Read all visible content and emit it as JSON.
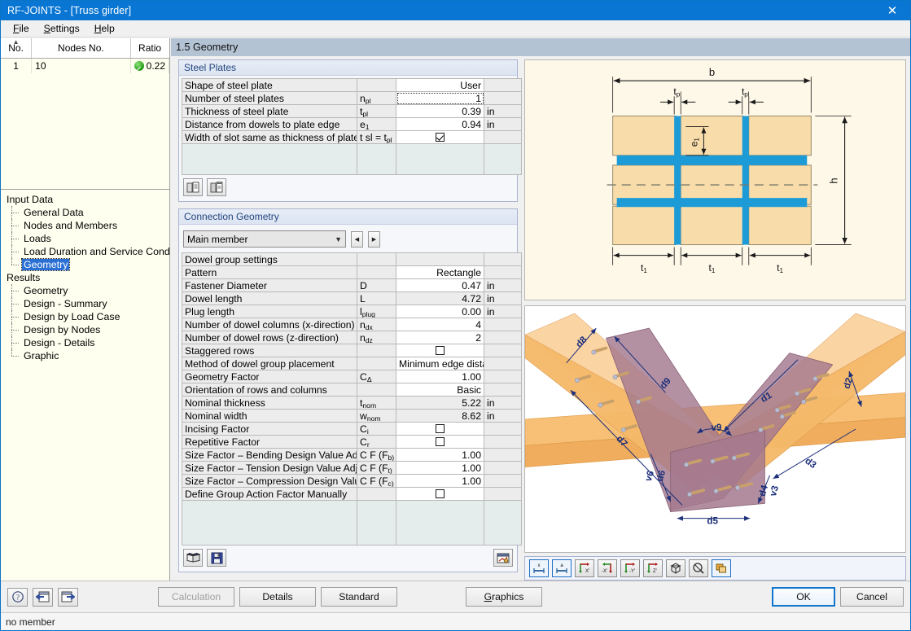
{
  "window": {
    "title": "RF-JOINTS - [Truss girder]",
    "close_label": "✕"
  },
  "menu": {
    "items": [
      {
        "pre": "",
        "accel": "F",
        "post": "ile"
      },
      {
        "pre": "",
        "accel": "S",
        "post": "ettings"
      },
      {
        "pre": "",
        "accel": "H",
        "post": "elp"
      }
    ]
  },
  "node_list": {
    "columns": [
      "No.",
      "Nodes No.",
      "Ratio"
    ],
    "rows": [
      {
        "no": "1",
        "nodes": "10",
        "ratio": "0.22",
        "status_icon": "check-circle-green"
      }
    ]
  },
  "tree": {
    "groups": [
      {
        "label": "Input Data",
        "children": [
          {
            "label": "General Data",
            "selected": false
          },
          {
            "label": "Nodes and Members",
            "selected": false
          },
          {
            "label": "Loads",
            "selected": false
          },
          {
            "label": "Load Duration and Service Conditions",
            "selected": false
          },
          {
            "label": "Geometry",
            "selected": true
          }
        ]
      },
      {
        "label": "Results",
        "children": [
          {
            "label": "Geometry",
            "selected": false
          },
          {
            "label": "Design - Summary",
            "selected": false
          },
          {
            "label": "Design by Load Case",
            "selected": false
          },
          {
            "label": "Design by Nodes",
            "selected": false
          },
          {
            "label": "Design - Details",
            "selected": false
          },
          {
            "label": "Graphic",
            "selected": false
          }
        ]
      }
    ]
  },
  "page": {
    "header": "1.5 Geometry"
  },
  "steel_plates": {
    "title": "Steel Plates",
    "rows": [
      {
        "label": "Shape of steel plate",
        "sym": "",
        "sym_sub": "",
        "value": "User",
        "unit": "",
        "type": "text",
        "readonly": false,
        "focused": false
      },
      {
        "label": "Number of steel plates",
        "sym": "n",
        "sym_sub": "pl",
        "value": "1",
        "unit": "",
        "type": "text",
        "readonly": false,
        "focused": true
      },
      {
        "label": "Thickness of steel plate",
        "sym": "t",
        "sym_sub": "pl",
        "value": "0.39",
        "unit": "in",
        "type": "text",
        "readonly": false,
        "focused": false
      },
      {
        "label": "Distance from dowels to plate edge",
        "sym": "e",
        "sym_sub": "1",
        "value": "0.94",
        "unit": "in",
        "type": "text",
        "readonly": false,
        "focused": false
      },
      {
        "label": "Width of slot same as thickness of plate",
        "sym": "t sl = t",
        "sym_sub": "pl",
        "value": "",
        "unit": "",
        "type": "checkbox",
        "checked": true,
        "readonly": false,
        "focused": false
      }
    ],
    "toolbar": [
      {
        "icon": "copy-from-icon"
      },
      {
        "icon": "paste-to-icon"
      }
    ]
  },
  "connection_geometry": {
    "title": "Connection Geometry",
    "member_select": {
      "value": "Main member",
      "caret_icon": "chevron-down-icon",
      "prev_icon": "triangle-left-icon",
      "next_icon": "triangle-right-icon"
    },
    "section_header": "Dowel group settings",
    "rows": [
      {
        "label": "Pattern",
        "sym": "",
        "sym_sub": "",
        "value": "Rectangle",
        "unit": "",
        "type": "text",
        "readonly": false
      },
      {
        "label": "Fastener Diameter",
        "sym": "D",
        "sym_sub": "",
        "value": "0.47",
        "unit": "in",
        "type": "text",
        "readonly": false
      },
      {
        "label": "Dowel length",
        "sym": "L",
        "sym_sub": "",
        "value": "4.72",
        "unit": "in",
        "type": "text",
        "readonly": true
      },
      {
        "label": "Plug length",
        "sym": "l",
        "sym_sub": "plug",
        "value": "0.00",
        "unit": "in",
        "type": "text",
        "readonly": false
      },
      {
        "label": "Number of dowel columns (x-direction)",
        "sym": "n",
        "sym_sub": "dx",
        "value": "4",
        "unit": "",
        "type": "text",
        "readonly": false
      },
      {
        "label": "Number of dowel rows (z-direction)",
        "sym": "n",
        "sym_sub": "dz",
        "value": "2",
        "unit": "",
        "type": "text",
        "readonly": false
      },
      {
        "label": "Staggered rows",
        "sym": "",
        "sym_sub": "",
        "value": "",
        "unit": "",
        "type": "checkbox",
        "checked": false,
        "readonly": false
      },
      {
        "label": "Method of dowel group placement",
        "sym": "",
        "sym_sub": "",
        "value": "Minimum edge distan",
        "unit": "",
        "type": "text",
        "readonly": false
      },
      {
        "label": "Geometry Factor",
        "sym": "C",
        "sym_sub": "Δ",
        "value": "1.00",
        "unit": "",
        "type": "text",
        "readonly": false
      },
      {
        "label": "Orientation of rows and columns",
        "sym": "",
        "sym_sub": "",
        "value": "Basic",
        "unit": "",
        "type": "text",
        "readonly": false
      },
      {
        "label": "Nominal thickness",
        "sym": "t",
        "sym_sub": "nom",
        "value": "5.22",
        "unit": "in",
        "type": "text",
        "readonly": true
      },
      {
        "label": "Nominal width",
        "sym": "w",
        "sym_sub": "nom",
        "value": "8.62",
        "unit": "in",
        "type": "text",
        "readonly": true
      },
      {
        "label": "Incising Factor",
        "sym": "C",
        "sym_sub": "i",
        "value": "",
        "unit": "",
        "type": "checkbox",
        "checked": false,
        "readonly": false
      },
      {
        "label": "Repetitive Factor",
        "sym": "C",
        "sym_sub": "r",
        "value": "",
        "unit": "",
        "type": "checkbox",
        "checked": false,
        "readonly": false
      },
      {
        "label": "Size Factor – Bending Design Value Adjustment",
        "sym": "C F (F",
        "sym_sub": "b)",
        "value": "1.00",
        "unit": "",
        "type": "text",
        "readonly": false
      },
      {
        "label": "Size Factor – Tension Design Value Adjustment",
        "sym": "C F (F",
        "sym_sub": "t)",
        "value": "1.00",
        "unit": "",
        "type": "text",
        "readonly": false
      },
      {
        "label": "Size Factor – Compression Design Value Adjustr",
        "sym": "C F (F",
        "sym_sub": "c)",
        "value": "1.00",
        "unit": "",
        "type": "text",
        "readonly": false
      },
      {
        "label": "Define Group Action Factor Manually",
        "sym": "",
        "sym_sub": "",
        "value": "",
        "unit": "",
        "type": "checkbox",
        "checked": false,
        "readonly": false
      }
    ],
    "toolbar": [
      {
        "icon": "library-book-icon"
      },
      {
        "icon": "save-floppy-icon"
      }
    ],
    "toolbar_right": {
      "icon": "settings-window-icon"
    }
  },
  "cross_section_drawing": {
    "labels": {
      "width": "b",
      "plate_thickness_left": "t",
      "plate_thickness_left_sub": "pl",
      "plate_thickness_right": "t",
      "plate_thickness_right_sub": "pl",
      "edge_distance": "e",
      "edge_distance_sub": "1",
      "height": "h",
      "t1_a": "t",
      "t1_a_sub": "1",
      "t1_b": "t",
      "t1_b_sub": "1",
      "t1_c": "t",
      "t1_c_sub": "1"
    },
    "colors": {
      "timber": "#f8ddab",
      "timber_stroke": "#9a8a6a",
      "steel": "#1d9bd7",
      "background": "#fdf8e8",
      "dimension": "#1a1a1a"
    }
  },
  "joint_3d_view": {
    "dimension_labels": [
      "d8",
      "d9",
      "d7",
      "v9",
      "d1",
      "d2",
      "d3",
      "v6",
      "d6",
      "d5",
      "d4",
      "v3"
    ],
    "colors": {
      "timber": "#f5b96a",
      "timber_light": "#fbd9a5",
      "plate": "#a4798e",
      "dimension": "#1b2f7a",
      "background": "#ffffff"
    }
  },
  "graphics_toolbar": {
    "buttons": [
      {
        "icon": "dimension-x-icon",
        "label": "x",
        "active": true
      },
      {
        "icon": "dimension-a-icon",
        "label": "a",
        "active": true
      },
      {
        "icon": "view-x-icon",
        "label": "X",
        "active": false
      },
      {
        "icon": "view-negx-icon",
        "label": "-X",
        "active": false
      },
      {
        "icon": "view-y-icon",
        "label": "-Y",
        "active": false
      },
      {
        "icon": "view-z-icon",
        "label": "Z",
        "active": false
      },
      {
        "icon": "isometric-cube-icon",
        "label": "",
        "active": false
      },
      {
        "icon": "zoom-rotate-icon",
        "label": "",
        "active": false
      },
      {
        "icon": "layers-icon",
        "label": "",
        "active": true
      }
    ]
  },
  "bottom_bar": {
    "icons": [
      {
        "icon": "help-question-icon"
      },
      {
        "icon": "previous-dialog-icon"
      },
      {
        "icon": "next-dialog-icon"
      }
    ],
    "buttons": [
      {
        "label": "Calculation",
        "disabled": true,
        "default": false,
        "accel": ""
      },
      {
        "label": "Details",
        "disabled": false,
        "default": false,
        "accel": ""
      },
      {
        "label": "Standard",
        "disabled": false,
        "default": false,
        "accel": ""
      }
    ],
    "graphics_button": {
      "pre": "",
      "accel": "G",
      "post": "raphics"
    },
    "ok_label": "OK",
    "cancel_label": "Cancel"
  },
  "status_bar": {
    "text": "no member"
  }
}
